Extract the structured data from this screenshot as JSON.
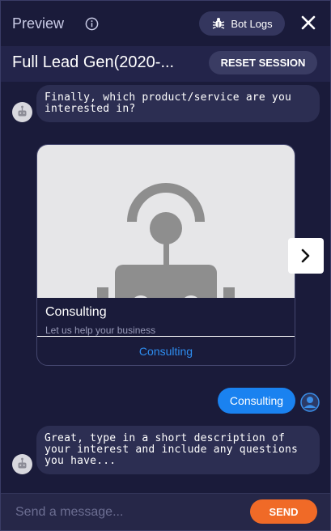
{
  "header": {
    "title": "Preview",
    "info_icon": "info-icon",
    "bot_logs_label": "Bot Logs",
    "bot_logs_icon": "bug-icon",
    "close_icon": "close-icon"
  },
  "session": {
    "bot_name": "Full Lead Gen(2020-...",
    "reset_label": "RESET SESSION"
  },
  "messages": [
    {
      "from": "bot",
      "text": "Finally, which product/service are you interested in?"
    },
    {
      "from": "bot_card",
      "card": {
        "title": "Consulting",
        "subtitle": "Let us help your business",
        "button_label": "Consulting",
        "image_icon": "robot-placeholder-icon"
      }
    },
    {
      "from": "user",
      "text": "Consulting"
    },
    {
      "from": "bot",
      "text": "Great, type in a short description of your interest and include any questions you have..."
    }
  ],
  "composer": {
    "placeholder": "Send a message...",
    "send_label": "SEND"
  },
  "colors": {
    "background": "#1a1b3a",
    "bot_bubble": "#2c2e52",
    "user_bubble": "#1a82f0",
    "send_button": "#f06a27",
    "card_button_text": "#2e8df0"
  }
}
